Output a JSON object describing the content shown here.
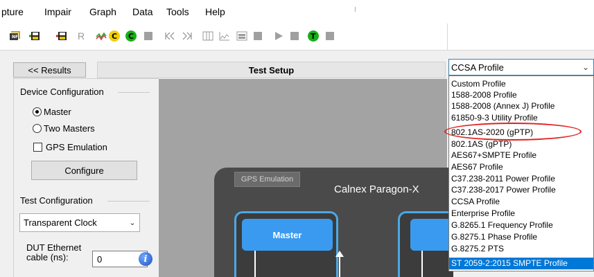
{
  "menu": [
    "pture",
    "Impair",
    "Graph",
    "Data",
    "Tools",
    "Help"
  ],
  "toolbar": {
    "icons": [
      "enf-icon",
      "save-config-icon",
      "save-config-alt-icon",
      "r-icon",
      "graph-icon",
      "c-yellow-icon",
      "c-green-icon",
      "stop-icon",
      "rewind-icon",
      "fast-forward-icon",
      "grid-icon",
      "chart-icon",
      "table-icon",
      "square-icon",
      "play-icon",
      "stop-icon-2",
      "t-green-icon",
      "square-icon-2"
    ],
    "r_label": "R",
    "c_label": "C",
    "t_label": "T"
  },
  "header": {
    "results_button": "<< Results",
    "title": "Test Setup"
  },
  "device_config": {
    "title": "Device Configuration",
    "master": "Master",
    "two_masters": "Two Masters",
    "gps_emulation": "GPS Emulation",
    "configure": "Configure",
    "selected": "Master"
  },
  "test_config": {
    "title": "Test Configuration",
    "mode": "Transparent Clock",
    "dut_label_1": "DUT Ethernet",
    "dut_label_2": "cable (ns):",
    "dut_value": "0"
  },
  "diagram": {
    "gps_tab": "GPS Emulation",
    "device_title": "Calnex Paragon-X",
    "master_box": "Master"
  },
  "profile": {
    "current": "CCSA Profile",
    "options": [
      "Custom Profile",
      "1588-2008 Profile",
      "1588-2008 (Annex J) Profile",
      "61850-9-3 Utility Profile",
      "802.1AS-2020 (gPTP)",
      "802.1AS (gPTP)",
      "AES67+SMPTE Profile",
      "AES67 Profile",
      "C37.238-2011 Power Profile",
      "C37.238-2017 Power Profile",
      "CCSA Profile",
      "Enterprise Profile",
      "G.8265.1 Frequency Profile",
      "G.8275.1 Phase Profile",
      "G.8275.2 PTS",
      "ST 2059-2:2015 SMPTE Profile"
    ],
    "highlighted": "ST 2059-2:2015 SMPTE Profile",
    "annotated": "802.1AS-2020 (gPTP)"
  },
  "colors": {
    "accent_blue": "#3a9af0",
    "selection": "#0078d7",
    "annotation_red": "#e02020",
    "device_dark": "#4a4a4a"
  }
}
